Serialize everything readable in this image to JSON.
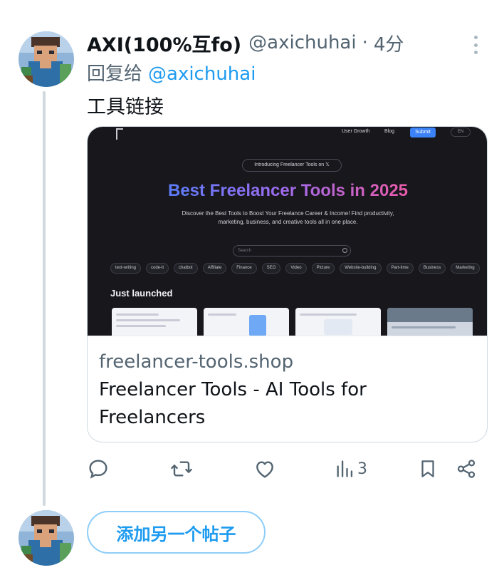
{
  "post": {
    "author": {
      "display_name": "AXI(100%互fo)",
      "handle": "@axichuhai",
      "separator": "·",
      "time": "4分"
    },
    "reply": {
      "prefix": "回复给",
      "mention": "@axichuhai"
    },
    "text": "工具链接",
    "card": {
      "domain": "freelancer-tools.shop",
      "title": "Freelancer Tools - AI Tools for Freelancers",
      "preview": {
        "nav": [
          "User Growth",
          "Blog"
        ],
        "submit": "Submit",
        "lang": "EN",
        "intro": "Introducing Freelancer Tools on 𝕏",
        "headline": "Best Freelancer Tools in 2025",
        "subtitle": "Discover the Best Tools to Boost Your Freelance Career & Income! Find productivity, marketing, business, and creative tools all in one place.",
        "search_placeholder": "Search",
        "tags": [
          "text-writing",
          "code-it",
          "chatbot",
          "Affiliate",
          "Finance",
          "SEO",
          "Video",
          "Picture",
          "Website-building",
          "Part-time",
          "Business",
          "Marketing"
        ],
        "section": "Just launched"
      }
    },
    "actions": {
      "views_count": "3"
    },
    "icons": [
      "more-icon",
      "reply-icon",
      "retweet-icon",
      "like-icon",
      "views-icon",
      "bookmark-icon",
      "share-icon"
    ]
  },
  "composer": {
    "add_post_label": "添加另一个帖子"
  },
  "colors": {
    "accent": "#1d9bf0",
    "muted": "#536471",
    "text": "#0f1419",
    "thread_line": "#cfd9de"
  }
}
